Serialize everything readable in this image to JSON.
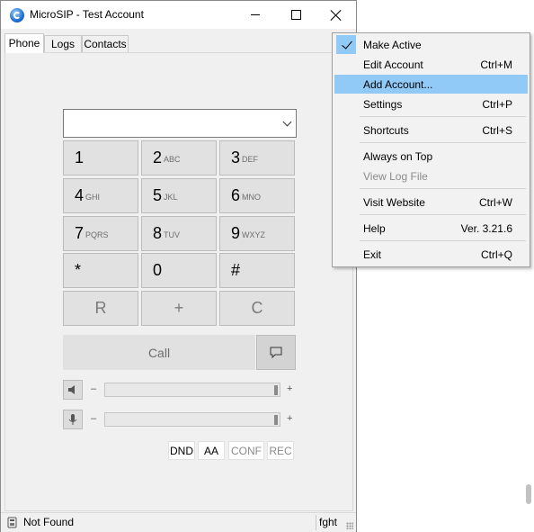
{
  "window": {
    "title": "MicroSIP - Test Account"
  },
  "tabs": [
    "Phone",
    "Logs",
    "Contacts"
  ],
  "dialpad": {
    "keys": [
      {
        "digit": "1",
        "letters": ""
      },
      {
        "digit": "2",
        "letters": "ABC"
      },
      {
        "digit": "3",
        "letters": "DEF"
      },
      {
        "digit": "4",
        "letters": "GHI"
      },
      {
        "digit": "5",
        "letters": "JKL"
      },
      {
        "digit": "6",
        "letters": "MNO"
      },
      {
        "digit": "7",
        "letters": "PQRS"
      },
      {
        "digit": "8",
        "letters": "TUV"
      },
      {
        "digit": "9",
        "letters": "WXYZ"
      },
      {
        "digit": "*",
        "letters": ""
      },
      {
        "digit": "0",
        "letters": ""
      },
      {
        "digit": "#",
        "letters": ""
      }
    ],
    "actions": [
      "R",
      "+",
      "C"
    ],
    "call_label": "Call"
  },
  "volume": {
    "minus": "–",
    "plus": "+",
    "speaker_level": 1.0,
    "mic_level": 1.0
  },
  "toggles": [
    "DND",
    "AA",
    "CONF",
    "REC"
  ],
  "status": {
    "text": "Not Found",
    "right": "fght"
  },
  "menu": {
    "items": [
      {
        "label": "Make Active",
        "shortcut": "",
        "checked": true
      },
      {
        "label": "Edit Account",
        "shortcut": "Ctrl+M"
      },
      {
        "label": "Add Account...",
        "shortcut": "",
        "highlighted": true
      },
      {
        "label": "Settings",
        "shortcut": "Ctrl+P"
      },
      {
        "label": "Shortcuts",
        "shortcut": "Ctrl+S"
      },
      {
        "label": "Always on Top",
        "shortcut": ""
      },
      {
        "label": "View Log File",
        "shortcut": "",
        "disabled": true
      },
      {
        "label": "Visit Website",
        "shortcut": "Ctrl+W"
      },
      {
        "label": "Help",
        "shortcut": "Ver. 3.21.6"
      },
      {
        "label": "Exit",
        "shortcut": "Ctrl+Q"
      }
    ]
  },
  "colors": {
    "highlight": "#91c9f7",
    "window_bg": "#f0f0f0",
    "key_bg": "#e1e1e1"
  }
}
